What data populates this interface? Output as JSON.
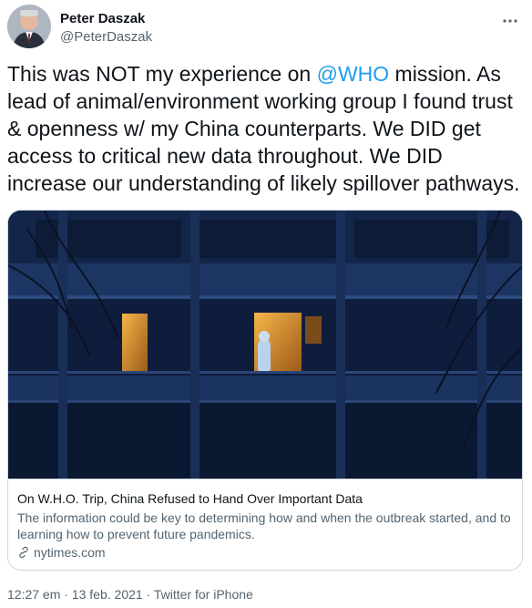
{
  "author": {
    "name": "Peter Daszak",
    "handle": "@PeterDaszak"
  },
  "tweet": {
    "text_before": "This was NOT my experience on ",
    "mention": "@WHO",
    "text_after": " mission. As lead of animal/environment working group I found trust & openness w/ my China counterparts. We DID get access to critical new data throughout. We DID increase our understanding of likely spillover pathways."
  },
  "card": {
    "title": "On W.H.O. Trip, China Refused to Hand Over Important Data",
    "description": "The information could be key to determining how and when the outbreak started, and to learning how to prevent future pandemics.",
    "domain": "nytimes.com"
  },
  "meta": {
    "time": "12:27 em",
    "separator": " · ",
    "date": "13 feb. 2021",
    "source": "Twitter for iPhone"
  },
  "icons": {
    "more": "more-dots-icon",
    "link": "link-icon"
  }
}
